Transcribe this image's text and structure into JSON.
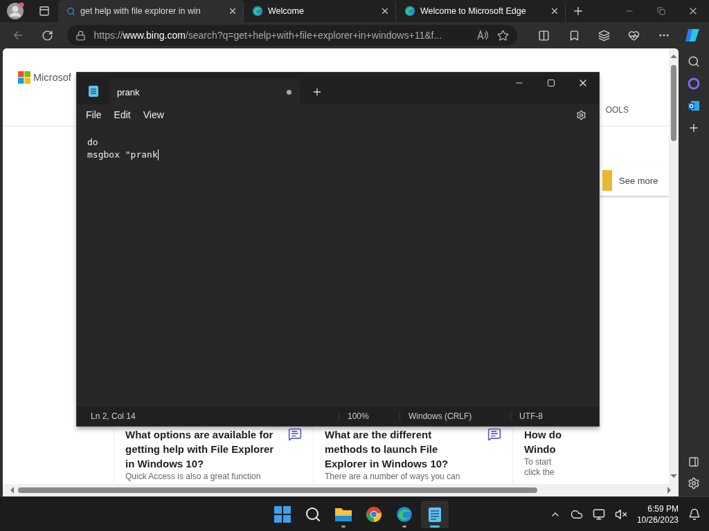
{
  "browser": {
    "tabs": [
      {
        "title": "get help with file explorer in win",
        "selected": true,
        "kind": "search"
      },
      {
        "title": "Welcome",
        "selected": false,
        "kind": "edge"
      },
      {
        "title": "Welcome to Microsoft Edge",
        "selected": false,
        "kind": "edge"
      }
    ],
    "address": {
      "scheme": "https://",
      "host": "www.bing.com",
      "path": "/search?q=get+help+with+file+explorer+in+windows+11&f..."
    }
  },
  "page": {
    "logo_text": "Microsof",
    "tools_label": "OOLS",
    "see_more": "See more",
    "cards": [
      {
        "title_lines": [
          "What options are available for",
          "getting help with File Explorer",
          "in Windows 10?"
        ],
        "snippet": "Quick Access is also a great function",
        "chat": true
      },
      {
        "title_lines": [
          "What are the different",
          "methods to launch File",
          "Explorer in Windows 10?"
        ],
        "snippet": "There are a number of ways you can",
        "chat": true
      },
      {
        "title_lines": [
          "How do",
          "Windo"
        ],
        "snippet": "To start",
        "snippet2": "click the",
        "chat": false
      }
    ]
  },
  "notepad": {
    "tab": "prank",
    "unsaved": true,
    "menu": [
      "File",
      "Edit",
      "View"
    ],
    "lines": [
      "do",
      "msgbox \"prank"
    ],
    "status": {
      "position": "Ln 2, Col 14",
      "zoom": "100%",
      "line_ending": "Windows (CRLF)",
      "encoding": "UTF-8"
    }
  },
  "taskbar": {
    "apps": [
      {
        "kind": "start",
        "running": false,
        "selected": false
      },
      {
        "kind": "search",
        "running": false,
        "selected": false
      },
      {
        "kind": "explorer",
        "running": true,
        "selected": false
      },
      {
        "kind": "chrome",
        "running": false,
        "selected": false
      },
      {
        "kind": "edge",
        "running": true,
        "selected": false
      },
      {
        "kind": "notepad",
        "running": true,
        "selected": true
      }
    ],
    "time": "6:59 PM",
    "date": "10/26/2023"
  }
}
